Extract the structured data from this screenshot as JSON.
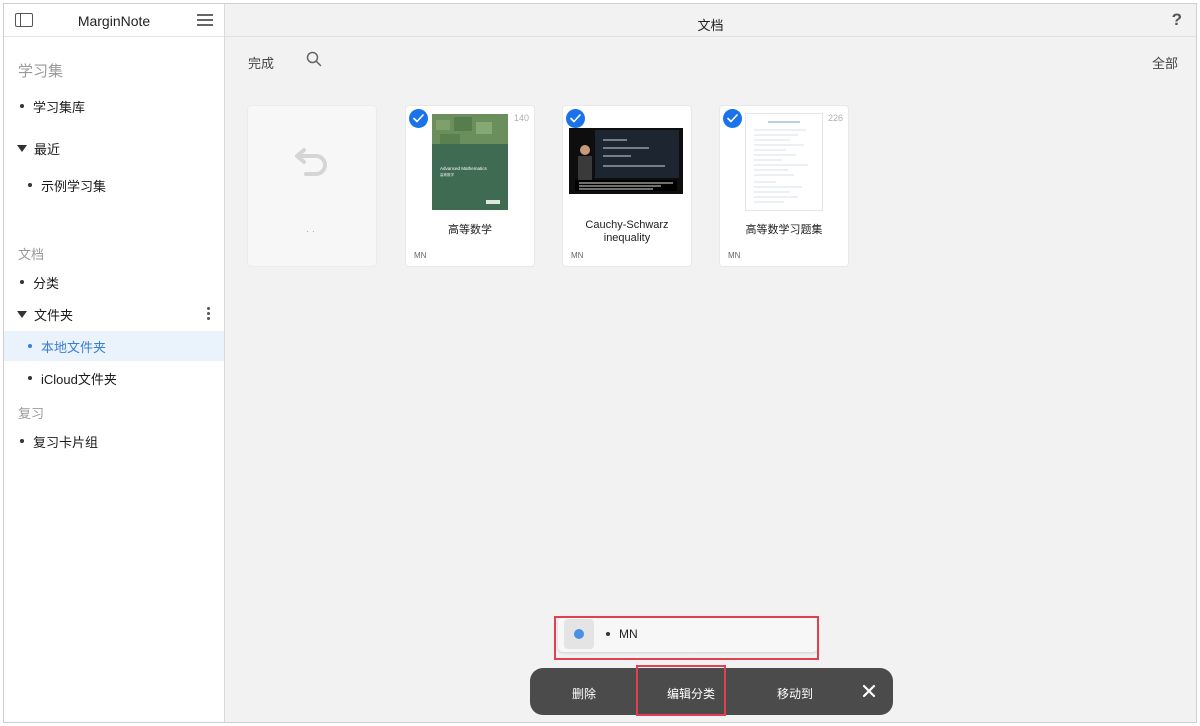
{
  "sidebar": {
    "app_title": "MarginNote",
    "section_study": "学习集",
    "study_library": "学习集库",
    "recent": "最近",
    "sample_study": "示例学习集",
    "section_docs": "文档",
    "category": "分类",
    "folders": "文件夹",
    "local_folder": "本地文件夹",
    "icloud_folder": "iCloud文件夹",
    "section_review": "复习",
    "review_decks": "复习卡片组"
  },
  "main": {
    "title": "文档",
    "help": "?",
    "done_label": "完成",
    "all_label": "全部",
    "back_dots": "..",
    "documents": [
      {
        "name": "高等数学",
        "pages": "140",
        "tag": "MN",
        "selected": true
      },
      {
        "name": "Cauchy-Schwarz inequality",
        "pages": "",
        "tag": "MN",
        "selected": true
      },
      {
        "name": "高等数学习题集",
        "pages": "226",
        "tag": "MN",
        "selected": true
      }
    ],
    "book_cover_title": "Advanced Mathematics",
    "book_cover_sub": "高等数学"
  },
  "tag_popup": {
    "tag_label": "MN"
  },
  "action_bar": {
    "delete_label": "删除",
    "edit_category_label": "编辑分类",
    "move_to_label": "移动到"
  },
  "colors": {
    "accent": "#1a73e8",
    "highlight": "#e04050",
    "action_bar_bg": "#4b4b4b",
    "active_sidebar_bg": "#eaf2fc"
  }
}
